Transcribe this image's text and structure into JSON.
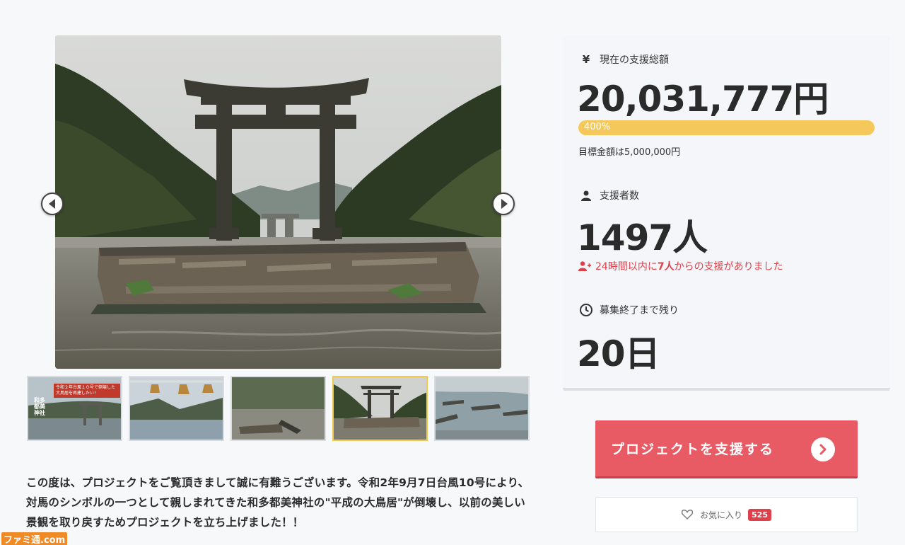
{
  "gallery": {
    "thumbnails": [
      {
        "caption": "令和２年台風１０号で倒壊した大鳥居を再建したい！",
        "vertical_text": "和多都美神社"
      },
      {
        "caption": ""
      },
      {
        "caption": ""
      },
      {
        "caption": ""
      },
      {
        "caption": ""
      }
    ],
    "active_thumbnail": 4
  },
  "funding": {
    "label": "現在の支援総額",
    "amount": "20,031,777円",
    "progress_text": "400%",
    "progress_percent": 400,
    "goal_text": "目標金額は5,000,000円"
  },
  "supporters": {
    "label": "支援者数",
    "count": "1497人",
    "recent_prefix": "24時間以内に",
    "recent_count": "7人",
    "recent_suffix": "からの支援がありました"
  },
  "remaining": {
    "label": "募集終了まで残り",
    "value": "20日"
  },
  "actions": {
    "support_label": "プロジェクトを支援する",
    "favorite_label": "お気に入り",
    "favorite_count": "525"
  },
  "description": "この度は、プロジェクトをご覧頂きまして誠に有難うございます。令和2年9月7日台風10号により、対馬のシンボルの一つとして親しまれてきた和多都美神社の\"平成の大鳥居\"が倒壊し、以前の美しい景観を取り戻すためプロジェクトを立ち上げました！！",
  "watermark": "ファミ通.com",
  "colors": {
    "accent": "#e85a64",
    "progress": "#f5c85b",
    "alert": "#e0404a",
    "active_thumb_border": "#f2c94c"
  }
}
